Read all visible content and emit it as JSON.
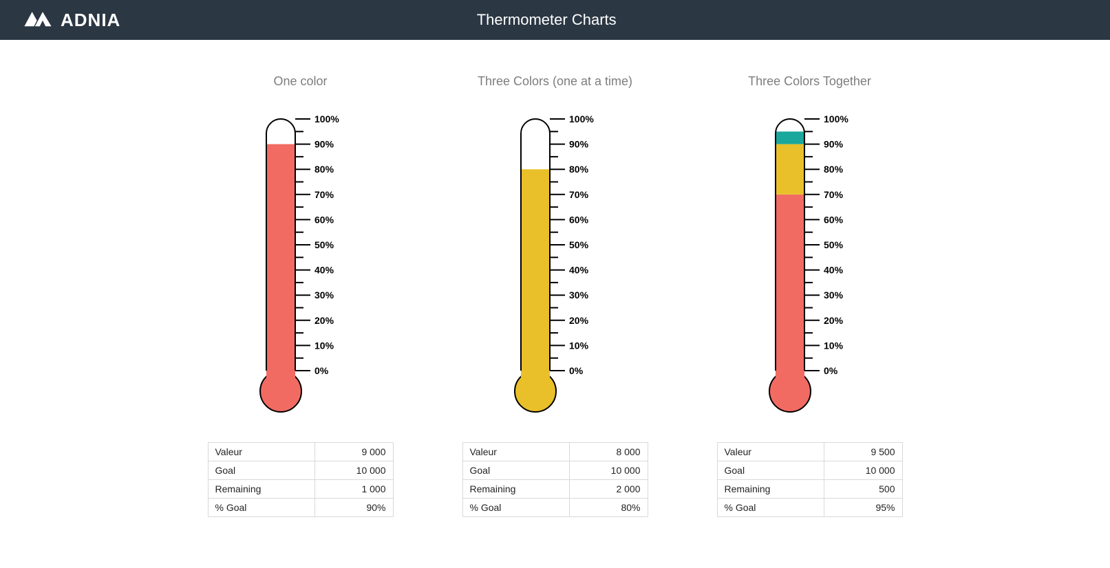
{
  "header": {
    "brand": "ADNIA",
    "title": "Thermometer Charts"
  },
  "row_labels": {
    "valeur": "Valeur",
    "goal": "Goal",
    "remaining": "Remaining",
    "pct_goal": "% Goal"
  },
  "colors": {
    "red": "#f16b62",
    "yellow": "#e9c029",
    "teal": "#1aa79c",
    "stroke": "#000000"
  },
  "charts": [
    {
      "title": "One color",
      "table": {
        "valeur": "9 000",
        "goal": "10 000",
        "remaining": "1 000",
        "pct_goal": "90%"
      }
    },
    {
      "title": "Three Colors (one at a time)",
      "table": {
        "valeur": "8 000",
        "goal": "10 000",
        "remaining": "2 000",
        "pct_goal": "80%"
      }
    },
    {
      "title": "Three Colors Together",
      "table": {
        "valeur": "9 500",
        "goal": "10 000",
        "remaining": "500",
        "pct_goal": "95%"
      }
    }
  ],
  "chart_data": [
    {
      "type": "bar",
      "title": "One color",
      "ylim": [
        0,
        100
      ],
      "ylabel": "%",
      "ticks": [
        "0%",
        "10%",
        "20%",
        "30%",
        "40%",
        "50%",
        "60%",
        "70%",
        "80%",
        "90%",
        "100%"
      ],
      "series": [
        {
          "name": "fill",
          "color": "#f16b62",
          "from": 0,
          "to": 90
        }
      ],
      "bulb_color": "#f16b62"
    },
    {
      "type": "bar",
      "title": "Three Colors (one at a time)",
      "ylim": [
        0,
        100
      ],
      "ylabel": "%",
      "ticks": [
        "0%",
        "10%",
        "20%",
        "30%",
        "40%",
        "50%",
        "60%",
        "70%",
        "80%",
        "90%",
        "100%"
      ],
      "series": [
        {
          "name": "fill",
          "color": "#e9c029",
          "from": 0,
          "to": 80
        }
      ],
      "bulb_color": "#e9c029"
    },
    {
      "type": "bar",
      "title": "Three Colors Together",
      "ylim": [
        0,
        100
      ],
      "ylabel": "%",
      "ticks": [
        "0%",
        "10%",
        "20%",
        "30%",
        "40%",
        "50%",
        "60%",
        "70%",
        "80%",
        "90%",
        "100%"
      ],
      "series": [
        {
          "name": "red",
          "color": "#f16b62",
          "from": 0,
          "to": 70
        },
        {
          "name": "yellow",
          "color": "#e9c029",
          "from": 70,
          "to": 90
        },
        {
          "name": "teal",
          "color": "#1aa79c",
          "from": 90,
          "to": 95
        }
      ],
      "bulb_color": "#f16b62"
    }
  ]
}
